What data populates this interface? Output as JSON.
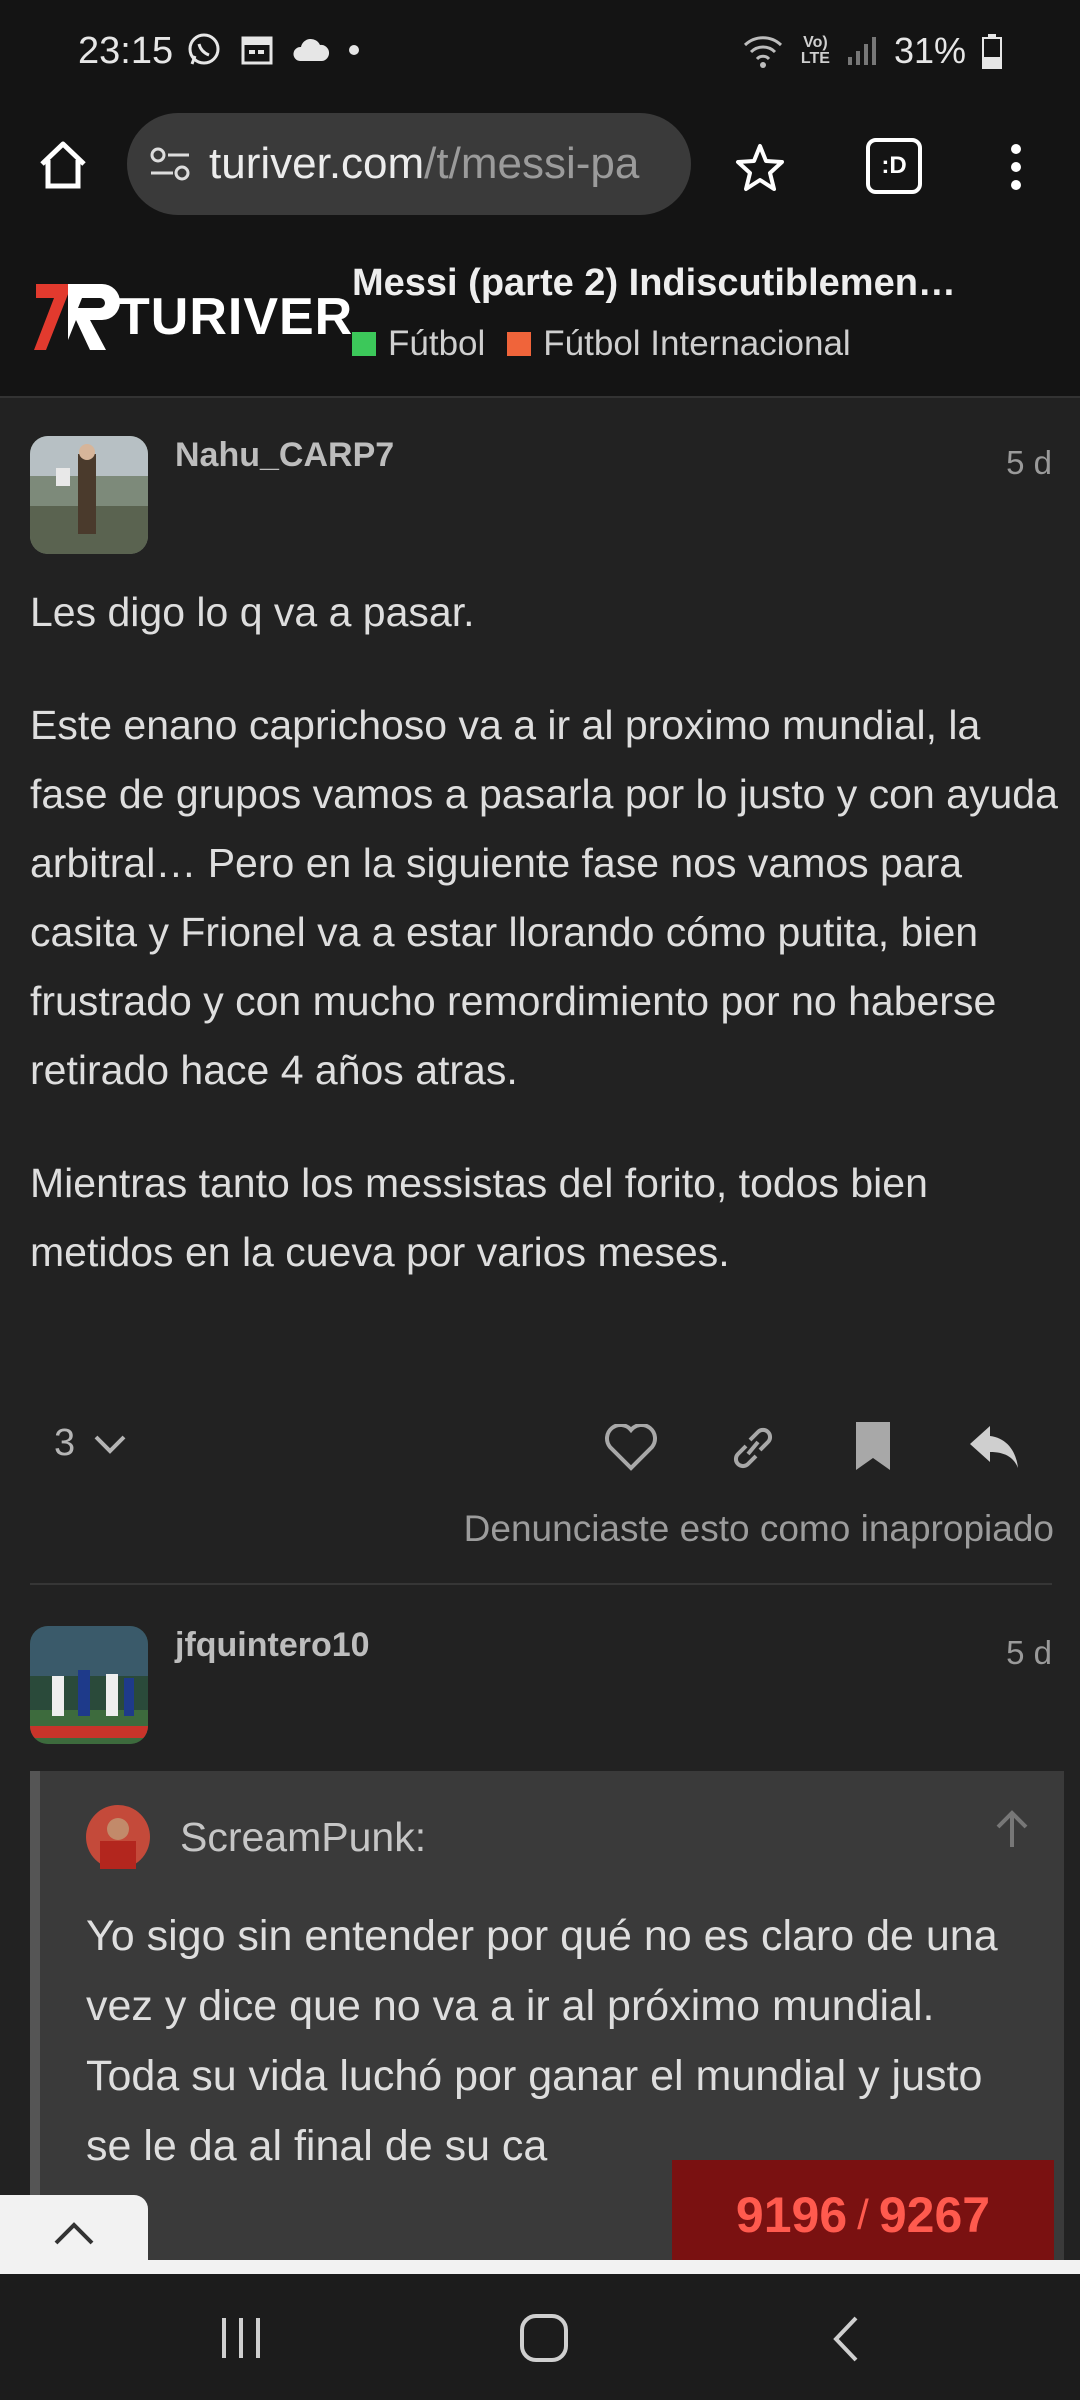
{
  "status_bar": {
    "time": "23:15",
    "battery": "31%",
    "left_icons": [
      "whatsapp-icon",
      "calendar-icon",
      "cloud-icon",
      "dot-icon"
    ],
    "right_icons": [
      "wifi-icon",
      "volte-icon",
      "signal-icon",
      "battery-icon"
    ]
  },
  "browser": {
    "url_domain": "turiver.com",
    "url_path": "/t/messi-pa",
    "tab_badge": ":D"
  },
  "forum": {
    "logo_text": "TURIVER",
    "topic_title": "Messi (parte 2) Indiscutiblemen…",
    "categories": [
      {
        "name": "Fútbol",
        "color": "#3cc85a"
      },
      {
        "name": "Fútbol Internacional",
        "color": "#f0643a"
      }
    ]
  },
  "posts": [
    {
      "username": "Nahu_CARP7",
      "date": "5 d",
      "paragraphs": [
        "Les digo lo q va a pasar.",
        "Este enano caprichoso va a ir al proximo mundial, la fase de grupos vamos a pasarla por lo justo y con ayuda arbitral… Pero en la siguiente fase nos vamos para casita y Frionel va a estar llorando cómo putita, bien frustrado y con mucho remordimiento por no haberse retirado hace 4 años atras.",
        "Mientras tanto los messistas del forito, todos bien metidos en la cueva por varios meses."
      ],
      "reply_count": "3",
      "flag_notice": "Denunciaste esto como inapropiado"
    },
    {
      "username": "jfquintero10",
      "date": "5 d",
      "quote": {
        "author": "ScreamPunk:",
        "lines": [
          "Yo sigo sin entender por qué no es claro de una vez y dice que no va a ir al próximo mundial.",
          "Toda su vida luchó por ganar el mundial y justo se le da al final de su ca"
        ]
      }
    }
  ],
  "progress": {
    "current": "9196",
    "separator": "/",
    "total": "9267"
  },
  "colors": {
    "background": "#222222",
    "header": "#141414",
    "accent_red": "#e23a2e",
    "progress_bg": "#7a1111",
    "progress_text": "#ff5a4e"
  }
}
